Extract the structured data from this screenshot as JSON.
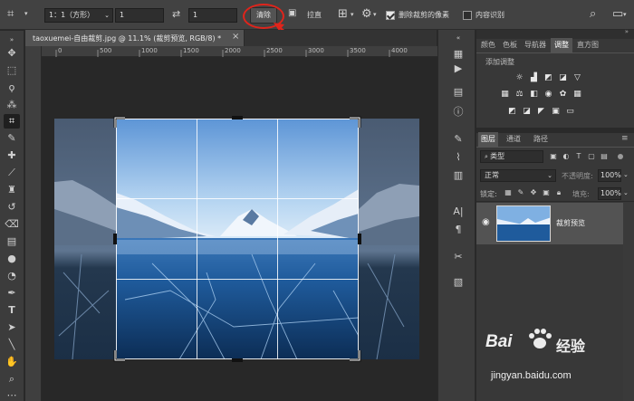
{
  "options_bar": {
    "ratio_value": "1：1（方形）",
    "width_value": "1",
    "height_value": "1",
    "clear_label": "清除",
    "straighten_label": "拉直",
    "delete_cropped_label": "删除裁剪的像素",
    "delete_cropped_checked": true,
    "content_aware_label": "内容识别",
    "content_aware_checked": false
  },
  "document": {
    "tab_title": "taoxuemei-自由裁剪.jpg @ 11.1% (裁剪预览, RGB/8) *",
    "close_glyph": "×"
  },
  "ruler": {
    "h_labels": [
      "0",
      "500",
      "1000",
      "1500",
      "2000",
      "2500",
      "3000",
      "3500",
      "4000"
    ]
  },
  "panels": {
    "top_tabs": [
      "颜色",
      "色板",
      "导航器",
      "调整",
      "直方图"
    ],
    "active_top_tab": "调整",
    "adjust_title": "添加调整",
    "layer_tabs": [
      "图层",
      "通道",
      "路径"
    ],
    "active_layer_tab": "图层",
    "filter_placeholder": "类型",
    "blend_mode": "正常",
    "opacity_label": "不透明度:",
    "opacity_value": "100%",
    "lock_label": "锁定:",
    "fill_label": "填充:",
    "fill_value": "100%",
    "layer_name": "裁剪预览"
  },
  "watermark": {
    "brand": "Bai",
    "brand_suffix": "经验",
    "url": "jingyan.baidu.com"
  },
  "colors": {
    "annotation_red": "#e0241b",
    "accent_blue": "#5e8fc7"
  }
}
